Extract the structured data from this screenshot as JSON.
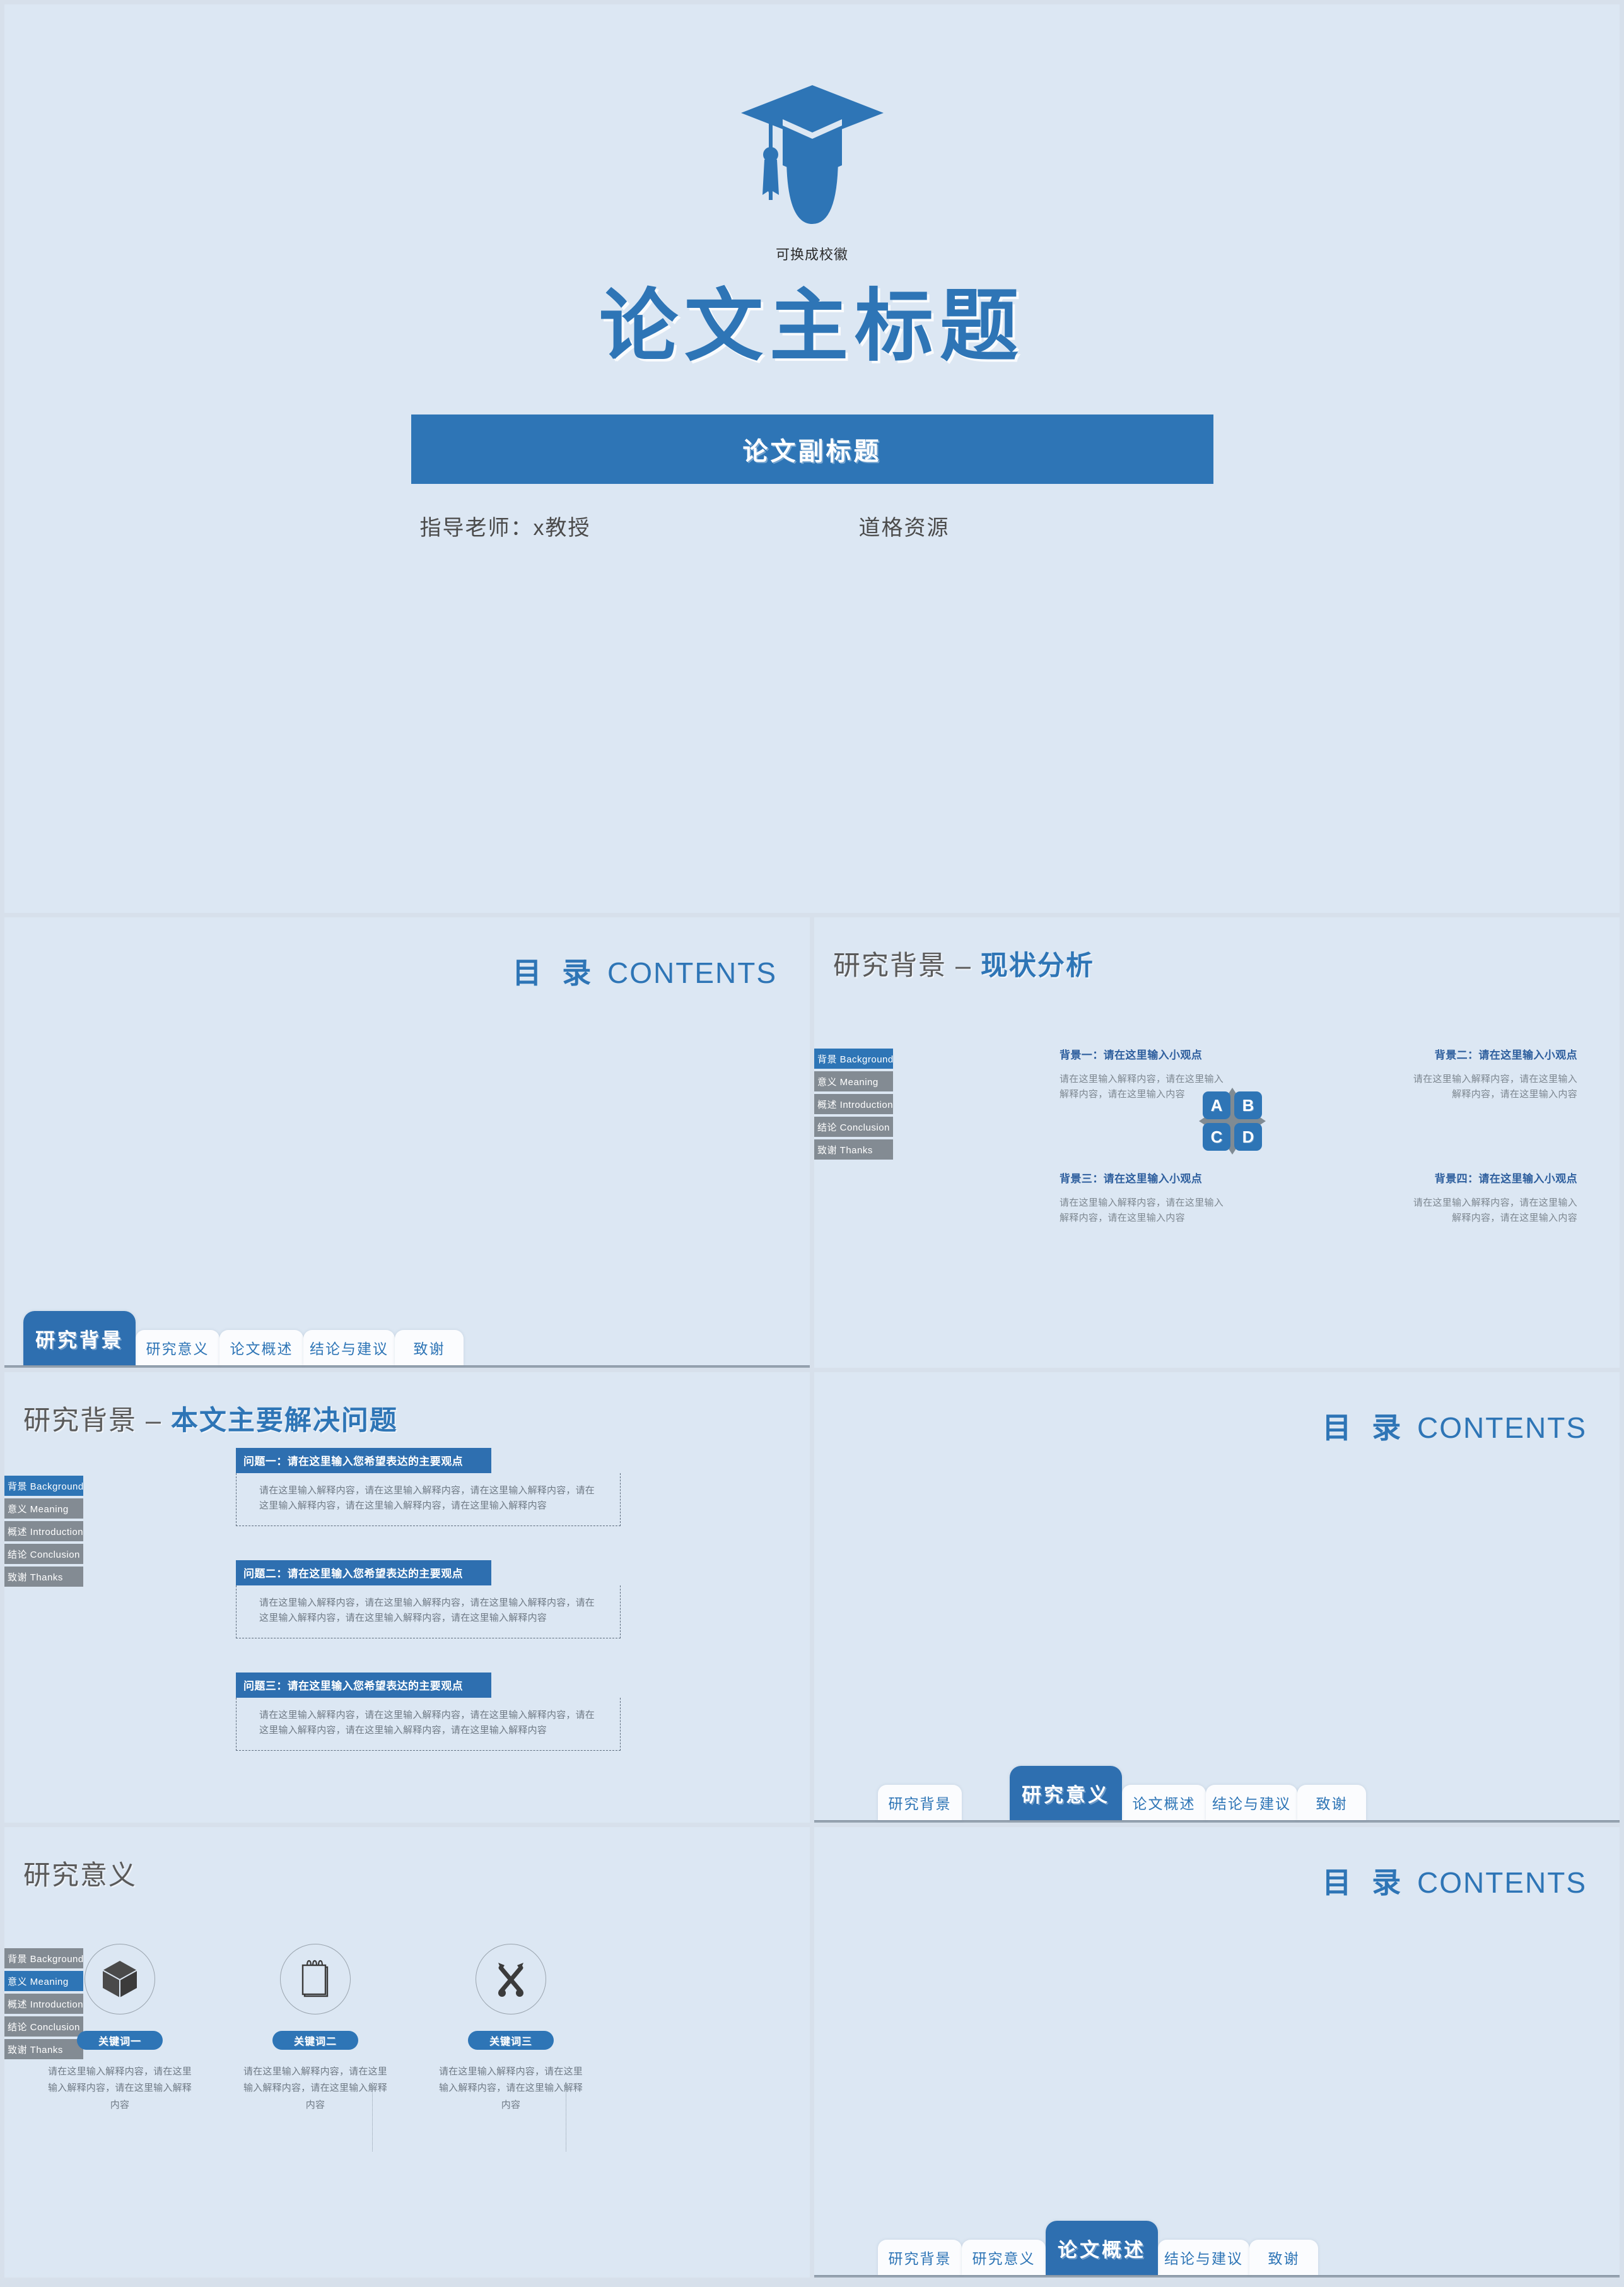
{
  "theme": {
    "background": "#dce7f3",
    "deck_gap": "#d7e0eb",
    "accent_blue": "#2e75b6",
    "tab_blue": "#2e6fb0",
    "rail_gray": "#838b93",
    "body_gray": "#7d8790",
    "heading_gray": "#5a5a5a"
  },
  "title_slide": {
    "logo_icon": "graduation-cap-icon",
    "logo_caption": "可换成校徽",
    "main_title": "论文主标题",
    "subtitle_bar": "论文副标题",
    "advisor": "指导老师：x教授",
    "source": "道格资源"
  },
  "contents_heading": {
    "cn": "目 录",
    "en": "CONTENTS"
  },
  "tabs": [
    "研究背景",
    "研究意义",
    "论文概述",
    "结论与建议",
    "致谢"
  ],
  "rail_menu": [
    "背景 Background",
    "意义 Meaning",
    "概述 Introduction",
    "结论 Conclusion",
    "致谢 Thanks"
  ],
  "slides": [
    {
      "id": "contents-1",
      "type": "contents",
      "active_tab_index": 0
    },
    {
      "id": "background-status",
      "type": "content",
      "title_dark": "研究背景 –",
      "title_blue": "现状分析",
      "active_rail_index": 0,
      "diagram": {
        "name": "abcd-quadrant-diagram",
        "cells": [
          "A",
          "B",
          "C",
          "D"
        ],
        "arrow_color": "#808b93",
        "cell_color": "#2e75b6"
      },
      "columns": [
        {
          "head": "背景一：请在这里输入小观点",
          "body": "请在这里输入解释内容，请在这里输入解释内容，请在这里输入内容"
        },
        {
          "head": "背景二：请在这里输入小观点",
          "body": "请在这里输入解释内容，请在这里输入解释内容，请在这里输入内容"
        },
        {
          "head": "背景三：请在这里输入小观点",
          "body": "请在这里输入解释内容，请在这里输入解释内容，请在这里输入内容"
        },
        {
          "head": "背景四：请在这里输入小观点",
          "body": "请在这里输入解释内容，请在这里输入解释内容，请在这里输入内容"
        }
      ]
    },
    {
      "id": "background-problems",
      "type": "content",
      "title_dark": "研究背景 –",
      "title_blue": "本文主要解决问题",
      "active_rail_index": 0,
      "problems": [
        {
          "head": "问题一：请在这里输入您希望表达的主要观点",
          "body": "请在这里输入解释内容，请在这里输入解释内容，请在这里输入解释内容，请在这里输入解释内容，请在这里输入解释内容，请在这里输入解释内容"
        },
        {
          "head": "问题二：请在这里输入您希望表达的主要观点",
          "body": "请在这里输入解释内容，请在这里输入解释内容，请在这里输入解释内容，请在这里输入解释内容，请在这里输入解释内容，请在这里输入解释内容"
        },
        {
          "head": "问题三：请在这里输入您希望表达的主要观点",
          "body": "请在这里输入解释内容，请在这里输入解释内容，请在这里输入解释内容，请在这里输入解释内容，请在这里输入解释内容，请在这里输入解释内容"
        }
      ]
    },
    {
      "id": "contents-2",
      "type": "contents",
      "active_tab_index": 1
    },
    {
      "id": "meaning-keywords",
      "type": "content",
      "title_dark": "研究意义",
      "title_blue": "",
      "active_rail_index": 1,
      "keywords": [
        {
          "icon": "cube-box-icon",
          "pill": "关键词一",
          "body": "请在这里输入解释内容，请在这里输入解释内容，请在这里输入解释内容"
        },
        {
          "icon": "notepad-icon",
          "pill": "关键词二",
          "body": "请在这里输入解释内容，请在这里输入解释内容，请在这里输入解释内容"
        },
        {
          "icon": "tools-wrench-hammer-icon",
          "pill": "关键词三",
          "body": "请在这里输入解释内容，请在这里输入解释内容，请在这里输入解释内容"
        }
      ]
    },
    {
      "id": "contents-3",
      "type": "contents",
      "active_tab_index": 2
    }
  ]
}
